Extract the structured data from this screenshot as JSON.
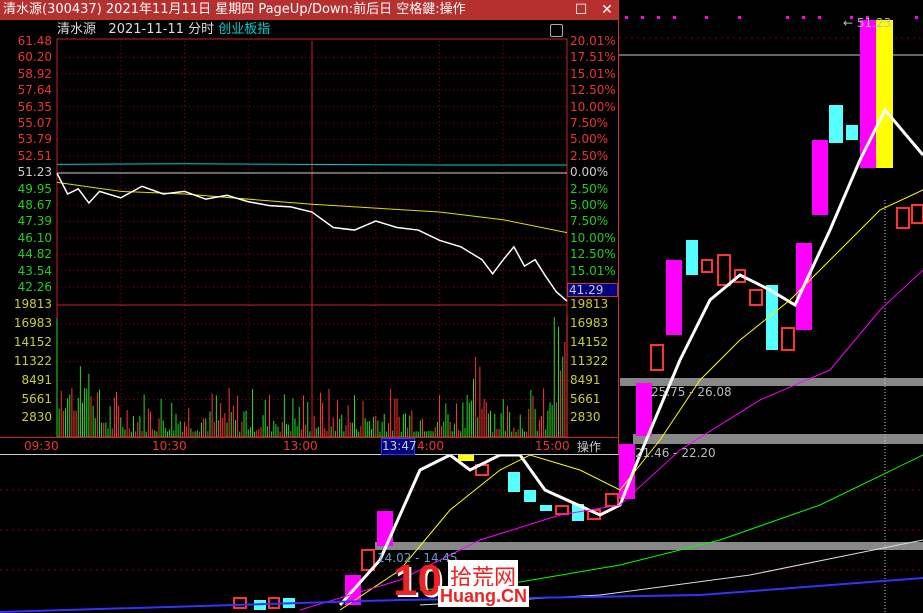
{
  "window": {
    "title": "清水源(300437) 2021年11月11日 星期四 PageUp/Down:前后日 空格鍵:操作",
    "maximize_icon": "square-icon",
    "close_icon": "x-icon"
  },
  "subheader": {
    "name": "清水源",
    "date": "2021-11-11",
    "mode": "分时",
    "index": "创业板指"
  },
  "price_axis": [
    "61.48",
    "60.20",
    "58.92",
    "57.64",
    "56.35",
    "55.07",
    "53.79",
    "52.51",
    "51.23",
    "49.95",
    "48.67",
    "47.39",
    "46.10",
    "44.82",
    "43.54",
    "42.26"
  ],
  "pct_axis": [
    "20.01%",
    "17.51%",
    "15.01%",
    "12.50%",
    "10.00%",
    "7.50%",
    "5.00%",
    "2.50%",
    "0.00%",
    "2.50%",
    "5.00%",
    "7.50%",
    "10.00%",
    "12.50%",
    "15.01%"
  ],
  "volume_axis": [
    "19813",
    "16983",
    "14152",
    "11322",
    "8491",
    "5661",
    "2830"
  ],
  "time_axis": {
    "t1": "09:30",
    "t2": "10:30",
    "t3": "13:00",
    "cursor": "13:47",
    "t4": "4:00",
    "t5": "15:00",
    "op": "操作"
  },
  "current_price": "41.29",
  "prev_close": 51.23,
  "price_series": [
    [
      0,
      51.2
    ],
    [
      5,
      49.6
    ],
    [
      10,
      50.0
    ],
    [
      15,
      48.9
    ],
    [
      20,
      49.8
    ],
    [
      30,
      49.3
    ],
    [
      40,
      50.2
    ],
    [
      50,
      49.6
    ],
    [
      60,
      49.8
    ],
    [
      70,
      49.2
    ],
    [
      80,
      49.5
    ],
    [
      90,
      49.0
    ],
    [
      100,
      48.7
    ],
    [
      110,
      48.6
    ],
    [
      120,
      48.2
    ],
    [
      130,
      47.0
    ],
    [
      140,
      46.8
    ],
    [
      150,
      47.5
    ],
    [
      160,
      47.0
    ],
    [
      170,
      46.8
    ],
    [
      180,
      46.0
    ],
    [
      190,
      45.5
    ],
    [
      200,
      44.5
    ],
    [
      205,
      43.4
    ],
    [
      210,
      44.5
    ],
    [
      215,
      45.5
    ],
    [
      220,
      44.0
    ],
    [
      225,
      44.5
    ],
    [
      230,
      43.2
    ],
    [
      235,
      42.0
    ],
    [
      240,
      41.29
    ]
  ],
  "avg_series": [
    [
      0,
      50.5
    ],
    [
      30,
      49.8
    ],
    [
      60,
      49.6
    ],
    [
      120,
      48.8
    ],
    [
      180,
      48.2
    ],
    [
      210,
      47.6
    ],
    [
      240,
      46.6
    ]
  ],
  "kline": {
    "high_label": "51.23",
    "zones": [
      "25.75 - 26.08",
      "21.46 - 22.20",
      "14.02 - 14.45"
    ]
  },
  "watermark": {
    "num": "10",
    "cn": "拾荒网",
    "en": "Huang.CN"
  }
}
